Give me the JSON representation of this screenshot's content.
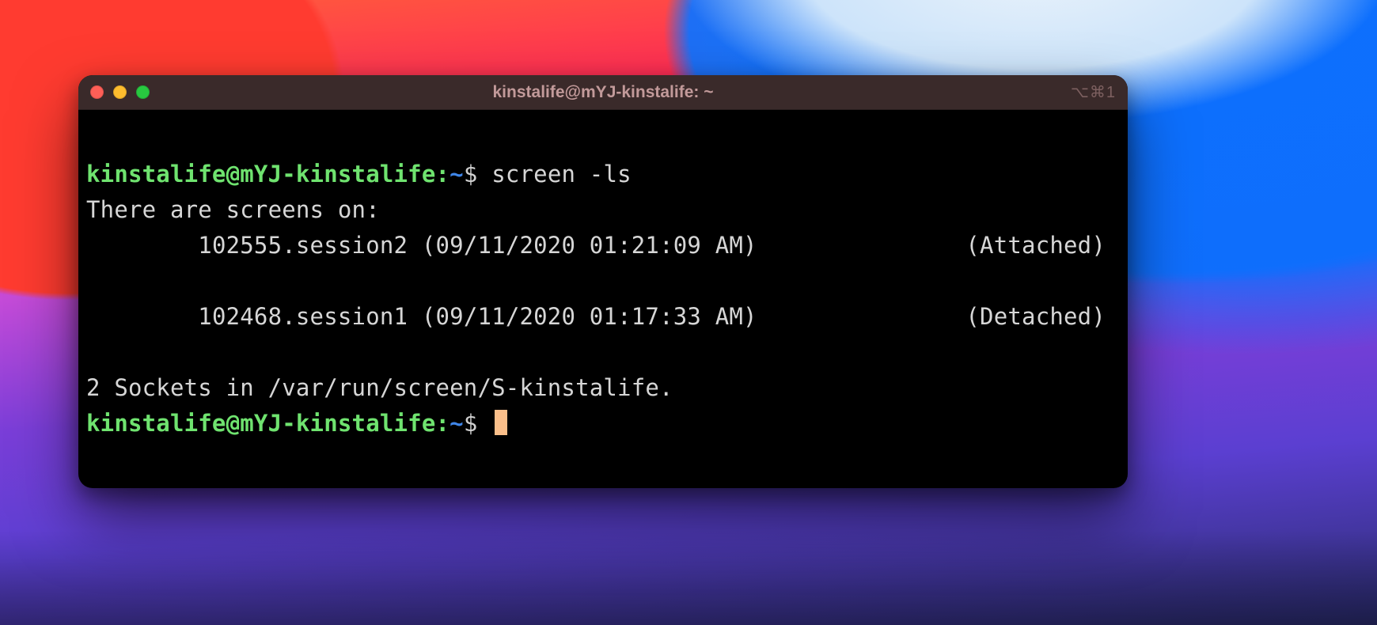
{
  "window": {
    "title": "kinstalife@mYJ-kinstalife: ~",
    "shortcut_hint": "⌥⌘1"
  },
  "prompt": {
    "user_host": "kinstalife@mYJ-kinstalife",
    "separator": ":",
    "path": "~",
    "symbol": "$"
  },
  "command": "screen -ls",
  "output": {
    "header": "There are screens on:",
    "sessions": [
      {
        "indent": "        ",
        "id": "102555.session2",
        "timestamp": "(09/11/2020 01:21:09 AM)",
        "status": "(Attached)"
      },
      {
        "indent": "        ",
        "id": "102468.session1",
        "timestamp": "(09/11/2020 01:17:33 AM)",
        "status": "(Detached)"
      }
    ],
    "footer": "2 Sockets in /var/run/screen/S-kinstalife."
  }
}
